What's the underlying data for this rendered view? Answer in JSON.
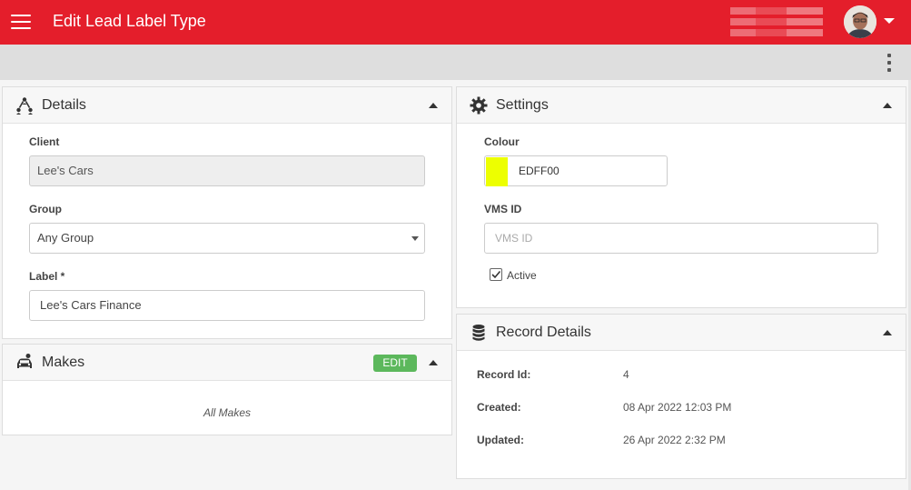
{
  "header": {
    "title": "Edit Lead Label Type",
    "avatar_icon": "user-avatar",
    "menu_icon": "hamburger-icon"
  },
  "colors": {
    "brand": "#e41e2b",
    "edit_button": "#5cb85c",
    "label_colour": "#EDFF00"
  },
  "details": {
    "title": "Details",
    "icon": "users-network-icon",
    "client_label": "Client",
    "client_value": "Lee's Cars",
    "group_label": "Group",
    "group_value": "Any Group",
    "label_label": "Label *",
    "label_value": "Lee's Cars Finance"
  },
  "makes": {
    "title": "Makes",
    "icon": "car-icon",
    "edit_label": "EDIT",
    "empty_text": "All Makes"
  },
  "settings": {
    "title": "Settings",
    "icon": "gear-icon",
    "colour_label": "Colour",
    "colour_value": "EDFF00",
    "vms_label": "VMS ID",
    "vms_placeholder": "VMS ID",
    "active_label": "Active",
    "active_checked": true
  },
  "record": {
    "title": "Record Details",
    "icon": "database-icon",
    "rows": [
      {
        "label": "Record Id:",
        "value": "4"
      },
      {
        "label": "Created:",
        "value": "08 Apr 2022 12:03 PM"
      },
      {
        "label": "Updated:",
        "value": "26 Apr 2022 2:32 PM"
      }
    ]
  }
}
